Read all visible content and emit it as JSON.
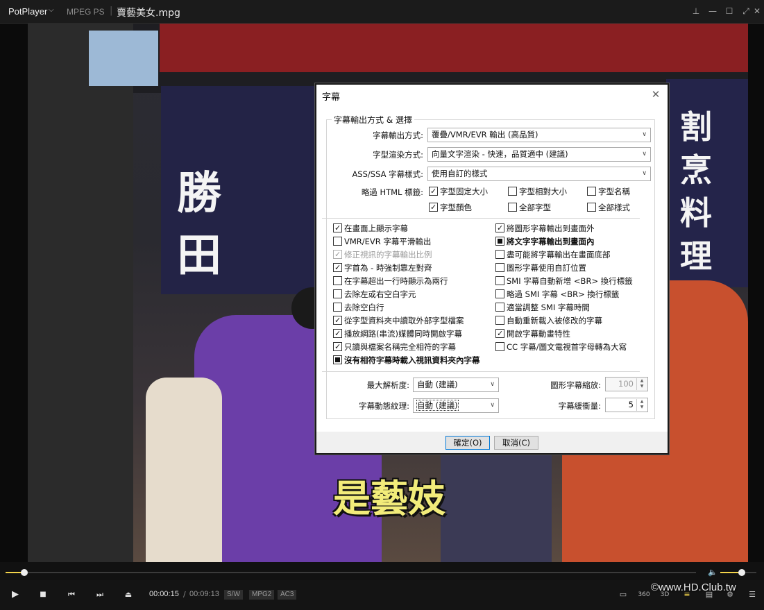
{
  "titlebar": {
    "app_name": "PotPlayer",
    "format": "MPEG PS",
    "filename": "賣藝美女.mpg"
  },
  "video": {
    "subtitle_text": "是藝妓",
    "banner_left": "勝田",
    "banner_right": "割烹料理"
  },
  "playback": {
    "current_time": "00:00:15",
    "separator": "/",
    "total_time": "00:09:13",
    "badges": [
      "S/W",
      "MPG2",
      "AC3"
    ],
    "progress_fraction": 0.027,
    "volume_fraction": 0.6
  },
  "watermark": "©www.HD.Club.tw",
  "dialog": {
    "title": "字幕",
    "group_legend": "字幕輸出方式 & 選擇",
    "fields": {
      "output_label": "字幕輸出方式:",
      "output_value": "覆疊/VMR/EVR 輸出 (高品質)",
      "render_label": "字型渲染方式:",
      "render_value": "向量文字渲染 - 快速，品質適中 (建議)",
      "ass_label": "ASS/SSA 字幕樣式:",
      "ass_value": "使用自訂的樣式",
      "html_label": "略過 HTML 標籤:"
    },
    "html_options": [
      {
        "label": "字型固定大小",
        "checked": true
      },
      {
        "label": "字型相對大小",
        "checked": false
      },
      {
        "label": "字型名稱",
        "checked": false
      },
      {
        "label": "字型顏色",
        "checked": true
      },
      {
        "label": "全部字型",
        "checked": false
      },
      {
        "label": "全部樣式",
        "checked": false
      }
    ],
    "left_options": [
      {
        "label": "在畫面上顯示字幕",
        "state": "on"
      },
      {
        "label": "VMR/EVR 字幕平滑輸出",
        "state": "off"
      },
      {
        "label": "修正視訊的字幕輸出比例",
        "state": "on",
        "disabled": true
      },
      {
        "label": "字首為 - 時強制靠左對齊",
        "state": "on"
      },
      {
        "label": "在字幕超出一行時顯示為兩行",
        "state": "off"
      },
      {
        "label": "去除左或右空白字元",
        "state": "off"
      },
      {
        "label": "去除空白行",
        "state": "off"
      },
      {
        "label": "從字型資料夾中讀取外部字型檔案",
        "state": "on"
      },
      {
        "label": "播放網路(串流)媒體同時開啟字幕",
        "state": "on"
      },
      {
        "label": "只讀與檔案名稱完全相符的字幕",
        "state": "on"
      },
      {
        "label": "沒有相符字幕時載入視訊資料夾內字幕",
        "state": "ind",
        "bold": true
      }
    ],
    "right_options": [
      {
        "label": "將圖形字幕輸出到畫面外",
        "state": "on"
      },
      {
        "label": "將文字字幕輸出到畫面內",
        "state": "ind",
        "bold": true
      },
      {
        "label": "盡可能將字幕輸出在畫面底部",
        "state": "off"
      },
      {
        "label": "圖形字幕使用自訂位置",
        "state": "off"
      },
      {
        "label": "SMI 字幕自動新增 <BR> 換行標籤",
        "state": "off"
      },
      {
        "label": "略過 SMI 字幕 <BR> 換行標籤",
        "state": "off"
      },
      {
        "label": "適當調整 SMI 字幕時間",
        "state": "off"
      },
      {
        "label": "自動重新載入被修改的字幕",
        "state": "off"
      },
      {
        "label": "開啟字幕動畫特性",
        "state": "on"
      },
      {
        "label": "CC 字幕/圖文電視首字母轉為大寫",
        "state": "off"
      }
    ],
    "bottom": {
      "max_res_label": "最大解析度:",
      "max_res_value": "自動 (建議)",
      "texture_label": "字幕動態紋理:",
      "texture_value": "自動 (建議)",
      "scale_label": "圖形字幕縮放:",
      "scale_value": "100",
      "buffer_label": "字幕緩衝量:",
      "buffer_value": "5"
    },
    "ok_label": "確定(O)",
    "cancel_label": "取消(C)"
  }
}
